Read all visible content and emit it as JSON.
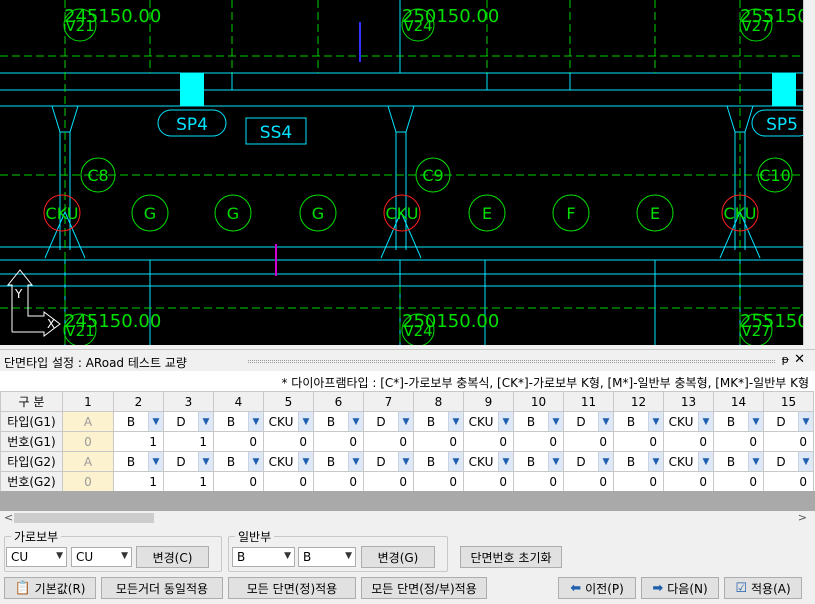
{
  "cad": {
    "stations": [
      "245150.00",
      "250150.00",
      "255150"
    ],
    "bubbles_top": [
      "V21",
      "V24",
      "V27"
    ],
    "bubbles_bottom": [
      "V21",
      "V24",
      "V27"
    ],
    "sp_labels": [
      "SP4",
      "SP5"
    ],
    "ss_label": "SS4",
    "column_labels": [
      "C8",
      "C9",
      "C10"
    ],
    "diaphragm_labels": [
      "CKU",
      "G",
      "G",
      "G",
      "CKU",
      "E",
      "F",
      "E",
      "CKU"
    ],
    "axis_y": "Y",
    "axis_x": "X"
  },
  "panel": {
    "title": "단면타입 설정 : ARoad 테스트 교량",
    "pin": "ᵽ",
    "close": "✕"
  },
  "note": "* 다이아프램타입 : [C*]-가로보부 충복식, [CK*]-가로보부 K형, [M*]-일반부 충복형, [MK*]-일반부 K형",
  "grid": {
    "header_label": "구 분",
    "columns": [
      "1",
      "2",
      "3",
      "4",
      "5",
      "6",
      "7",
      "8",
      "9",
      "10",
      "11",
      "12",
      "13",
      "14",
      "15"
    ],
    "rows": [
      {
        "label": "타입(G1)",
        "kind": "type",
        "cells": [
          "A",
          "B",
          "D",
          "B",
          "CKU",
          "B",
          "D",
          "B",
          "CKU",
          "B",
          "D",
          "B",
          "CKU",
          "B",
          "D"
        ]
      },
      {
        "label": "번호(G1)",
        "kind": "num",
        "cells": [
          "0",
          "1",
          "1",
          "0",
          "0",
          "0",
          "0",
          "0",
          "0",
          "0",
          "0",
          "0",
          "0",
          "0",
          "0"
        ]
      },
      {
        "label": "타입(G2)",
        "kind": "type",
        "cells": [
          "A",
          "B",
          "D",
          "B",
          "CKU",
          "B",
          "D",
          "B",
          "CKU",
          "B",
          "D",
          "B",
          "CKU",
          "B",
          "D"
        ]
      },
      {
        "label": "번호(G2)",
        "kind": "num",
        "cells": [
          "0",
          "1",
          "1",
          "0",
          "0",
          "0",
          "0",
          "0",
          "0",
          "0",
          "0",
          "0",
          "0",
          "0",
          "0"
        ]
      }
    ]
  },
  "cross_beam": {
    "legend": "가로보부",
    "combo1": "CU",
    "combo2": "CU",
    "change_button": "변경(C)"
  },
  "general": {
    "legend": "일반부",
    "combo1": "B",
    "combo2": "B",
    "change_button": "변경(G)"
  },
  "reset_button": "단면번호 초기화",
  "footer": {
    "default_button": "기본값(R)",
    "all_girder_button": "모든거더 동일적용",
    "all_section_main_button": "모든 단면(정)적용",
    "all_section_main_sub_button": "모든 단면(정/부)적용",
    "prev_button": "이전(P)",
    "next_button": "다음(N)",
    "apply_button": "적용(A)"
  },
  "colors": {
    "cad_bg": "#000000",
    "cyan": "#00ffff",
    "green": "#00ff00",
    "red": "#ff0000",
    "first_col_bg": "#fdf2d0",
    "dropdown_bg": "#dfe8f6"
  }
}
